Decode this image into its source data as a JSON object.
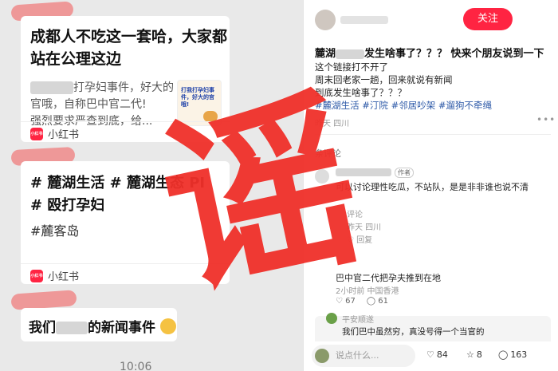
{
  "chat": {
    "card1": {
      "title_line1": "成都人不吃这一套哈，大家都",
      "title_line2": "站在公理这边",
      "body_line1_suffix": "打孕妇事件，好大的",
      "body_line2": "官哦，自称巴中官二代!",
      "body_line3": "强烈要求严查到底，给...",
      "thumb_text": "打我打孕妇事件，好大的官哦!",
      "source": "小红书",
      "logo": "小红书"
    },
    "card2": {
      "tags_line1": "# 麓湖生活 # 麓湖生态        PI",
      "tags_line2": "# 殴打孕妇",
      "tags_line3": "#麓客岛",
      "source": "小红书",
      "logo": "小红书"
    },
    "bubble": {
      "prefix": "我们",
      "suffix": "的新闻事件"
    },
    "time": "10:06"
  },
  "post": {
    "follow": "关注",
    "title_prefix": "麓湖",
    "title_suffix": "发生啥事了？？？ 快来个朋友说到一下",
    "body": [
      "这个链接打不开了",
      "周末回老家一趟，回来就说有新闻",
      "到底发生啥事了？？？"
    ],
    "tags": "#麓湖生活 #汀院 #邻居吵架 #遛狗不牵绳",
    "meta": "昨天 四川",
    "more": "•••",
    "comments_head": "条评论",
    "comment1": {
      "author_tag": "作者",
      "text": "可以讨论理性吃瓜，不站队，是是非非谁也说不清",
      "sub": "评论",
      "meta": "昨天 四川",
      "reply": "回复"
    },
    "comment2": {
      "text": "巴中官二代把孕夫推到在地",
      "meta": "2小时前 中国香港",
      "likes": "67",
      "replies": "61"
    },
    "comment3": {
      "name": "平安顺遂",
      "text": "我们巴中虽然穷，真没号得一个当官的"
    },
    "bottom": {
      "placeholder": "说点什么...",
      "likes": "84",
      "stars": "8",
      "comments": "163"
    }
  },
  "stamp": {
    "char": "谣",
    "color": "#f0302a"
  }
}
